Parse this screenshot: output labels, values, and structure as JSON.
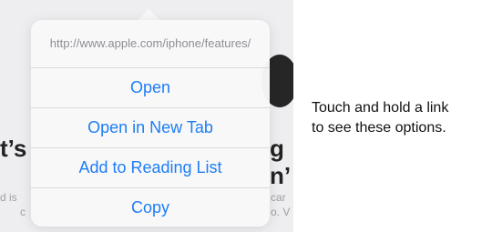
{
  "popover": {
    "url": "http://www.apple.com/iphone/features/",
    "items": [
      {
        "label": "Open"
      },
      {
        "label": "Open in New Tab"
      },
      {
        "label": "Add to Reading List"
      },
      {
        "label": "Copy"
      }
    ]
  },
  "caption": {
    "line1": "Touch and hold a link",
    "line2": "to see these options."
  },
  "background": {
    "frag_left_top": "t’s",
    "frag_right_top": "g",
    "frag_right_mid": "n’",
    "frag_left_small_1": "d is",
    "frag_left_small_2": "c",
    "frag_right_small_1": "car",
    "frag_right_small_2": "o. V"
  },
  "colors": {
    "accent": "#1e7ef5",
    "url_text": "#8e8e93",
    "page_background": "#eeeef0"
  }
}
